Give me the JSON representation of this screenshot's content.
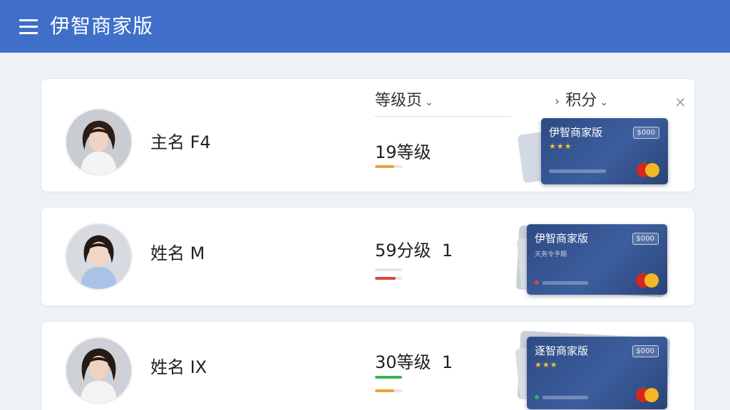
{
  "header": {
    "title": "伊智商家版",
    "menu_icon": "menu-icon"
  },
  "columns": {
    "level_label": "等级页",
    "points_label": "积分",
    "chevron": "⌄",
    "prev_arrow": "›",
    "close": "×"
  },
  "rows": [
    {
      "name": "主名 F4",
      "level_text": "19等级",
      "level_suffix": "",
      "bars": [
        {
          "fraction": 0.7,
          "color": "#e8a43a"
        }
      ],
      "member_card": {
        "title": "伊智商家版",
        "amount": "$000",
        "stars": "★★★",
        "subtitle": ""
      }
    },
    {
      "name": "姓名 M",
      "level_text": "59分级",
      "level_suffix": "1",
      "bars": [
        {
          "fraction": 0.0,
          "color": "#d7dbe0"
        },
        {
          "fraction": 0.75,
          "color": "#d9443f"
        }
      ],
      "member_card": {
        "title": "伊智商家版",
        "amount": "$000",
        "stars": "",
        "subtitle": "天务令予期"
      }
    },
    {
      "name": "姓名 IX",
      "level_text": "30等级",
      "level_suffix": "1",
      "bars": [
        {
          "fraction": 1.0,
          "color": "#31b55a"
        },
        {
          "fraction": 0.7,
          "color": "#e8a43a"
        }
      ],
      "member_card": {
        "title": "逐智商家版",
        "amount": "$000",
        "stars": "★★★",
        "subtitle": ""
      }
    }
  ]
}
